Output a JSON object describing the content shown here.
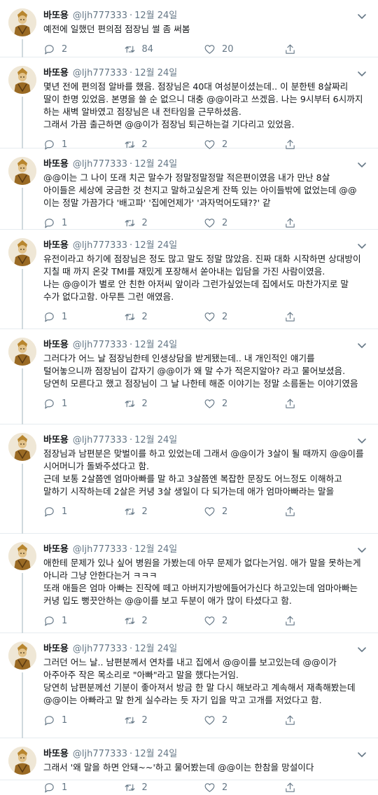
{
  "author": {
    "name": "바또용",
    "handle": "@ljh777333",
    "date": "12월 24일"
  },
  "colors": {
    "text": "#14171a",
    "muted": "#657786",
    "border": "#e6ecf0",
    "thread_line": "#cfd9de"
  },
  "tweets": [
    {
      "text": "예전에 일했던 편의점 점장님 썰 좀 써봄",
      "replies": "2",
      "retweets": "84",
      "likes": "20"
    },
    {
      "text": "몇년 전에 편의점 알바를 했음. 점장님은 40대 여성분이셨는데.. 이 분한텐 8살짜리 딸이 한명 있었음. 본명을 쓸 순 없으니 대충 @@이라고 쓰겠음. 나는 9시부터 6시까지 하는 새벽 알바였고 점장님은 내 전타임을 근무하셨음.\n그래서 가끔 출근하면 @@이가 점장님 퇴근하는걸 기다리고 있었음.",
      "replies": "1",
      "retweets": "2",
      "likes": "2"
    },
    {
      "text": "@@이는 그 나이 또래 치곤 말수가 정말정말정말 적은편이였음 내가 만난 8살 아이들은 세상에 궁금한 것 천지고 말하고싶은게 잔뜩 있는 아이들밖에 없었는데 @@이는 정말 가끔가다 '배고파' '집에언제가' '과자먹어도돼??' 같",
      "replies": "1",
      "retweets": "2",
      "likes": "2"
    },
    {
      "text": "유전이라고 하기에 점장님은 정도 많고 말도 정말 많았음. 진짜 대화 시작하면 상대방이 지칠 때 까지 온갖 TMI를 재밌게 포장해서 쏟아내는 입담을 가진 사람이였음.\n나는 @@이가 별로 안 친한 아저씨 앞이라 그런가싶었는데 집에서도 마찬가지로 말 수가 없다고함. 아무튼 그런 애였음.",
      "replies": "1",
      "retweets": "2",
      "likes": "2"
    },
    {
      "text": "그러다가 어느 날 점장님한테 인생상담을 받게됐는데.. 내 개인적인 얘기를 털어놓으니까 점장님이 갑자기 @@이가 왜 말 수가 적은지알아? 라고 물어보셨음. 당연히 모른다고 했고 점장님이 그 날 나한테 해준 이야기는 정말 소름돋는 이야기였음",
      "replies": "1",
      "retweets": "2",
      "likes": "2"
    },
    {
      "text": "점장님과 남편분은 맞벌이를 하고 있었는데 그래서 @@이가 3살이 될 때까지 @@이를 시어머니가 돌봐주셨다고 함.\n근데 보통 2살쯤엔 엄마아빠를 말 하고 3살쯤엔 복잡한 문장도 어느정도 이해하고 말하기 시작하는데 2살은 커녕 3살 생일이 다 되가는데 애가 엄마아빠라는 말을 못했다고 함.",
      "replies": "1",
      "retweets": "2",
      "likes": "2"
    },
    {
      "text": "애한테 문제가 있나 싶어 병원을 가봤는데 아무 문제가 없다는거임. 애가 말을 못하는게 아니라 그냥 안한다는거 ㅋㅋㅋ\n또래 애들은 엄마 아빠는 진작에 떼고 아버지가방에들어가신다 하고있는데 엄마아빠는 커녕 입도 뻥끗안하는 @@이를 보고 두분이 애가 많이 타셨다고 함.",
      "replies": "1",
      "retweets": "2",
      "likes": "2"
    },
    {
      "text": "그러던 어느 날.. 남편분께서 연차를 내고 집에서 @@이를 보고있는데 @@이가 아주아주 작은 목소리로 \"아빠\"라고 말을 했다는거임.\n당연히 남편분께선 기분이 좋아져서 방금 한 말 다시 해보라고 계속해서 재촉해봤는데 @@이는 아빠라고 말 한게 실수라는 듯 자기 입을 막고 고개를 저었다고 함.",
      "replies": "1",
      "retweets": "2",
      "likes": "2"
    },
    {
      "text": "그래서 '왜 말을 하면 안돼~~'하고 물어봤는데 @@이는 한참을 망설이다",
      "replies": "1",
      "retweets": "2",
      "likes": "2"
    }
  ]
}
